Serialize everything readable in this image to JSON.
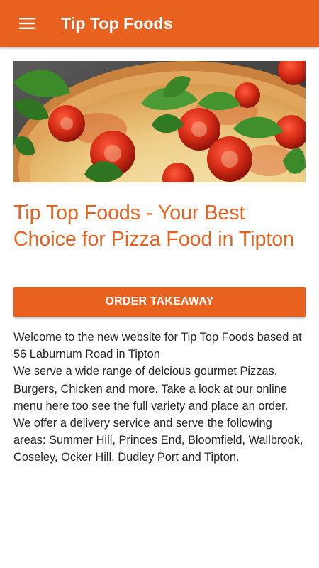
{
  "header": {
    "menu_icon": "hamburger-menu-icon",
    "title": "Tip Top Foods",
    "background_color": "#e8611f"
  },
  "hero": {
    "image": "pizza-photo"
  },
  "main": {
    "headline": "Tip Top Foods - Your Best Choice for Pizza Food in Tipton",
    "order_button_label": "ORDER TAKEAWAY",
    "paragraphs": [
      "Welcome to the new website for Tip Top Foods based at 56 Laburnum Road in Tipton",
      "We serve a wide range of delcious gourmet Pizzas, Burgers, Chicken and more. Take a look at our online menu here too see the full variety and place an order.",
      "We offer a delivery service and serve the following areas: Summer Hill, Princes End, Bloomfield, Wallbrook, Coseley, Ocker Hill, Dudley Port and Tipton."
    ]
  },
  "colors": {
    "accent": "#e8611f",
    "text": "#262626"
  }
}
